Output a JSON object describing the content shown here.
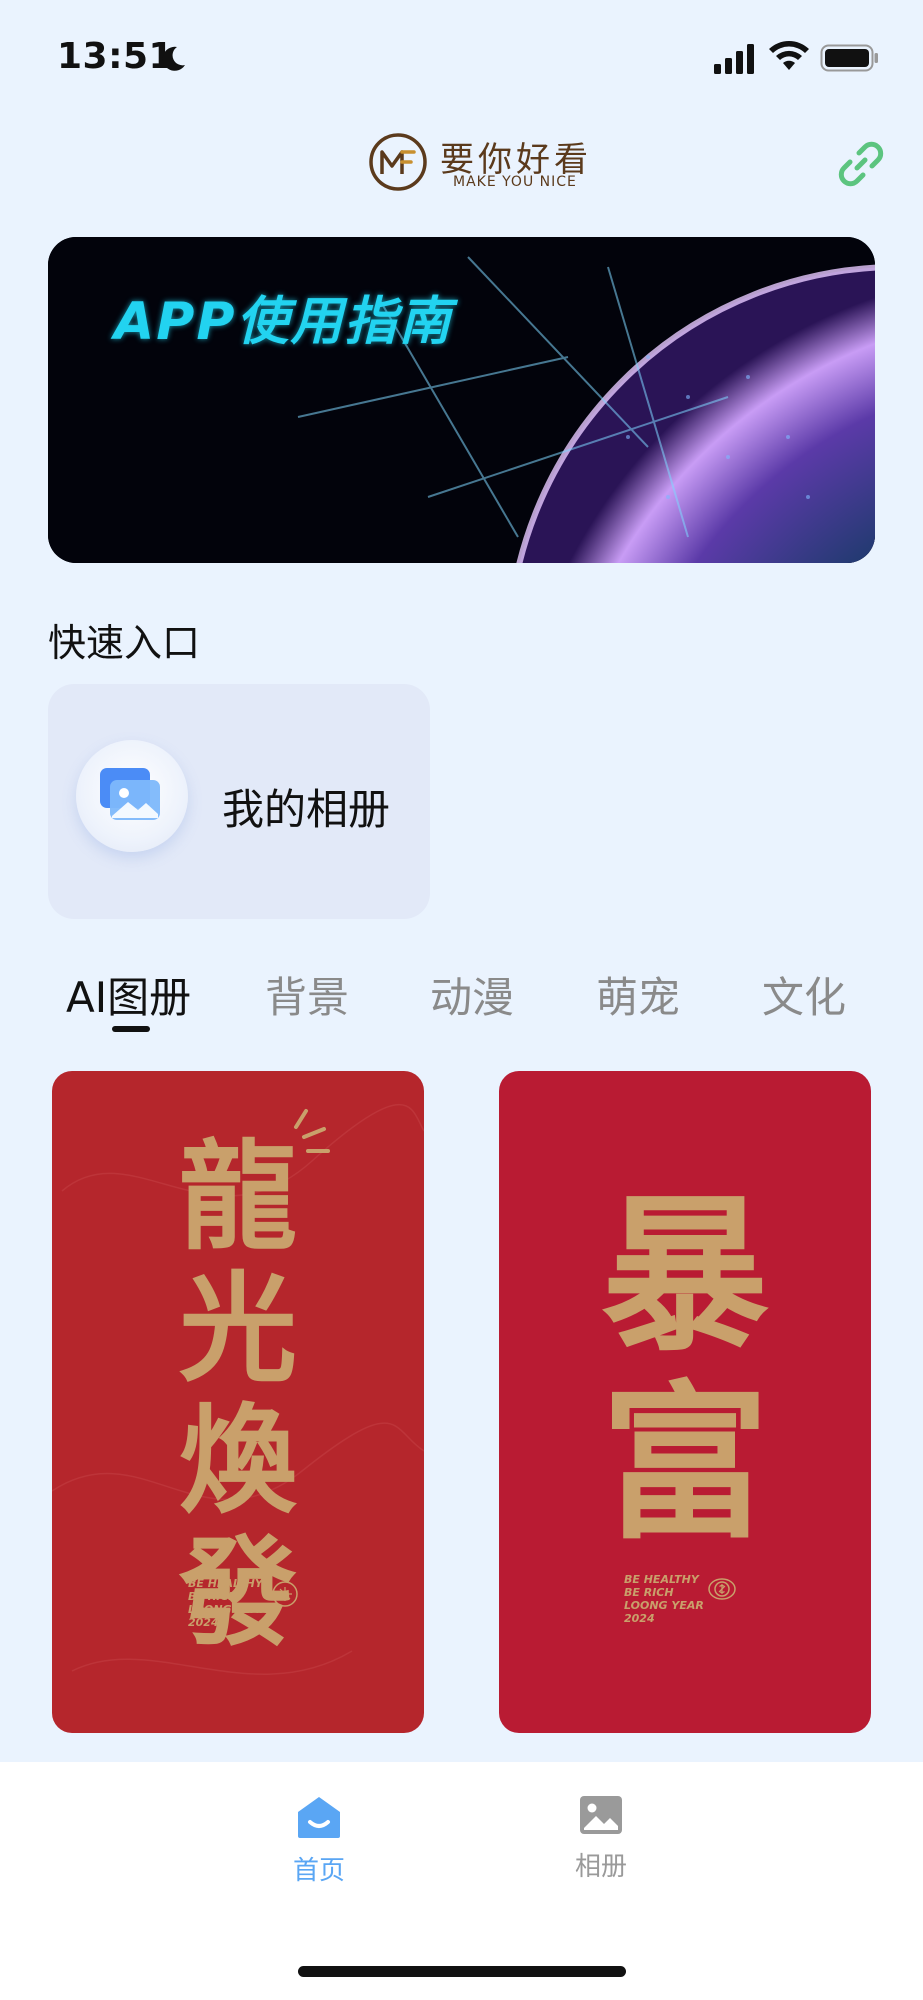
{
  "status_bar": {
    "time": "13:51",
    "icons": [
      "moon-icon",
      "signal-icon",
      "wifi-icon",
      "battery-icon"
    ]
  },
  "header": {
    "logo_title": "要你好看",
    "logo_subtitle": "MAKE YOU NICE",
    "logo_colors": {
      "brand": "#5B3A1C"
    },
    "right_icon": "link-icon",
    "right_icon_color": "#5CC47F"
  },
  "banner": {
    "text": "APP使用指南",
    "text_color": "#22d3f0"
  },
  "quick_entry": {
    "title": "快速入口",
    "items": [
      {
        "label": "我的相册",
        "icon": "album-icon"
      }
    ]
  },
  "category_tabs": {
    "items": [
      {
        "label": "AI图册",
        "active": true
      },
      {
        "label": "背景",
        "active": false
      },
      {
        "label": "动漫",
        "active": false
      },
      {
        "label": "萌宠",
        "active": false
      },
      {
        "label": "文化",
        "active": false
      }
    ]
  },
  "cards": [
    {
      "title_chars": "龍光煥發",
      "caption": [
        "BE HEALTHY",
        "BE RICH",
        "LOONG YEAR",
        "2024"
      ],
      "background": "#B5262C",
      "accent": "#C9A06B"
    },
    {
      "title_chars": "暴富",
      "caption": [
        "BE HEALTHY",
        "BE RICH",
        "LOONG YEAR",
        "2024"
      ],
      "background": "#B91B33",
      "accent": "#C9A06B"
    }
  ],
  "bottom_nav": {
    "items": [
      {
        "label": "首页",
        "icon": "home-icon",
        "active": true
      },
      {
        "label": "相册",
        "icon": "image-icon",
        "active": false
      }
    ],
    "active_color": "#5AA6F4",
    "inactive_color": "#9a9a9a"
  }
}
